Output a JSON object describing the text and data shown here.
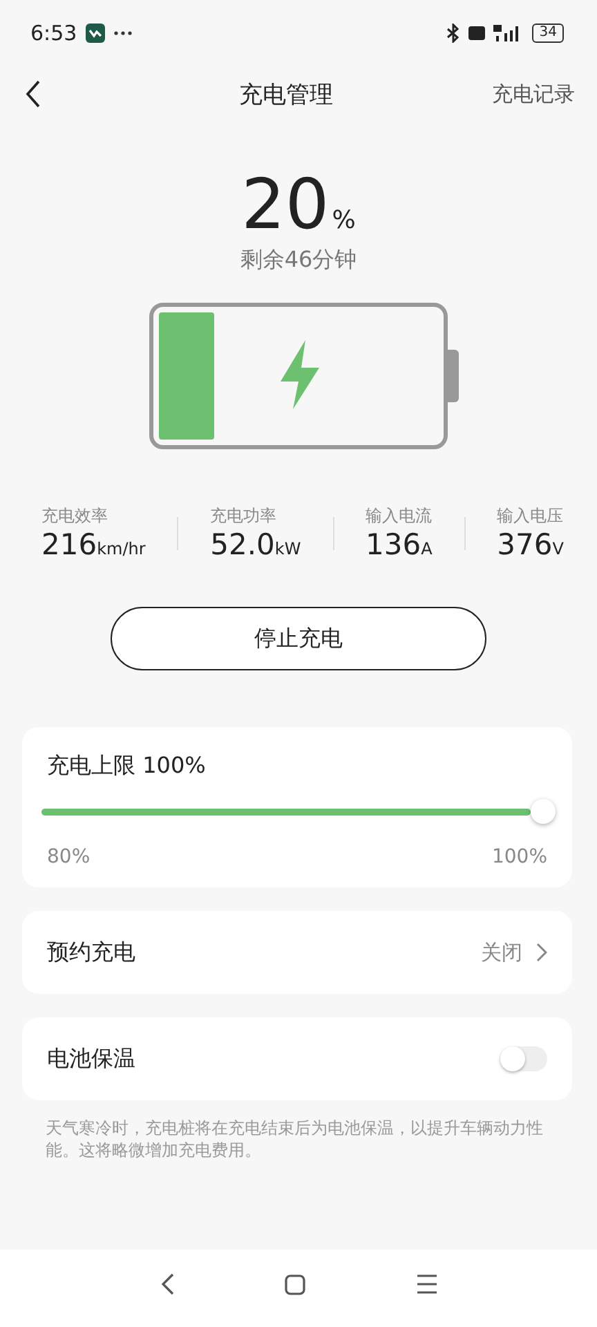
{
  "status_bar": {
    "time": "6:53",
    "battery": "34"
  },
  "header": {
    "title": "充电管理",
    "action": "充电记录"
  },
  "charge": {
    "percent": "20",
    "unit": "%",
    "remaining": "剩余46分钟"
  },
  "stats": [
    {
      "label": "充电效率",
      "value": "216",
      "unit": "km/hr"
    },
    {
      "label": "充电功率",
      "value": "52.0",
      "unit": "kW"
    },
    {
      "label": "输入电流",
      "value": "136",
      "unit": "A"
    },
    {
      "label": "输入电压",
      "value": "376",
      "unit": "V"
    }
  ],
  "stop_button": "停止充电",
  "limit": {
    "label": "充电上限 100%",
    "level": 1,
    "min_label": "80%",
    "max_label": "100%"
  },
  "schedule": {
    "label": "预约充电",
    "value": "关闭"
  },
  "battery_warming": {
    "label": "电池保温",
    "on": false
  },
  "note": "天气寒冷时，充电桩将在充电结束后为电池保温，以提升车辆动力性能。这将略微增加充电费用。"
}
